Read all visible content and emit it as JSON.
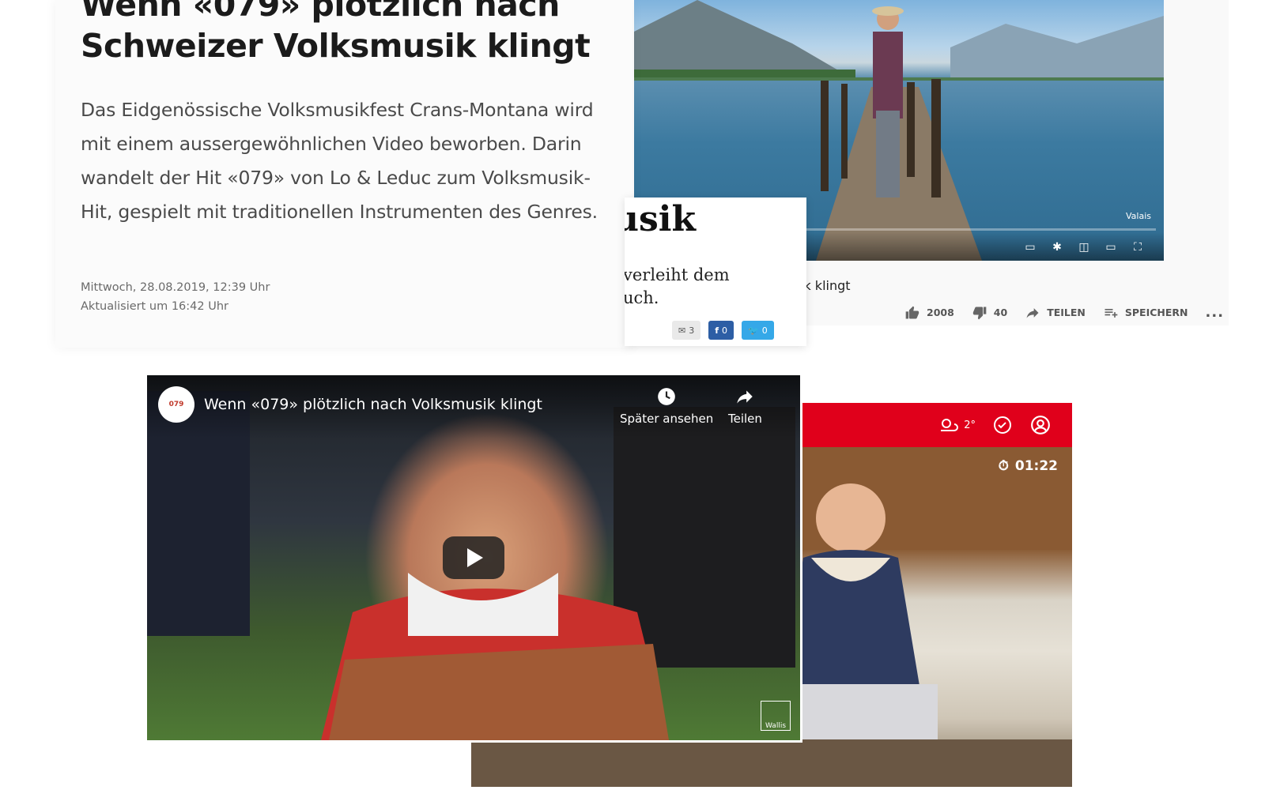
{
  "article": {
    "title": "Wenn «079» plötzlich nach Schweizer Volksmusik klingt",
    "lead": "Das Eidgenössische Volksmusikfest Crans-Montana wird mit einem aussergewöhnlichen Video beworben. Darin wandelt der Hit «079» von Lo & Leduc zum Volksmusik-Hit, gespielt mit traditionellen Instrumenten des Genres.",
    "published": "Mittwoch, 28.08.2019, 12:39 Uhr",
    "updated": "Aktualisiert um 16:42 Uhr"
  },
  "youtube": {
    "watermark": "Valais",
    "caption": "ik klingt",
    "likes": "2008",
    "dislikes": "40",
    "share_label": "TEILEN",
    "save_label": "SPEICHERN",
    "more_label": "..."
  },
  "overlay_article": {
    "headline_fragment": "usik",
    "text_line1": "verleiht dem",
    "text_line2": "uch.",
    "mail_count": "3",
    "fb_count": "0",
    "tw_count": "0"
  },
  "fb_video": {
    "title": "Wenn «079» plötzlich nach Volksmusik klingt",
    "avatar_text": "079",
    "watch_later_label": "Später ansehen",
    "share_label": "Teilen",
    "watermark": "Wallis"
  },
  "news_app": {
    "temperature": "2°",
    "duration": "01:22",
    "brand_color": "#e0001b"
  }
}
